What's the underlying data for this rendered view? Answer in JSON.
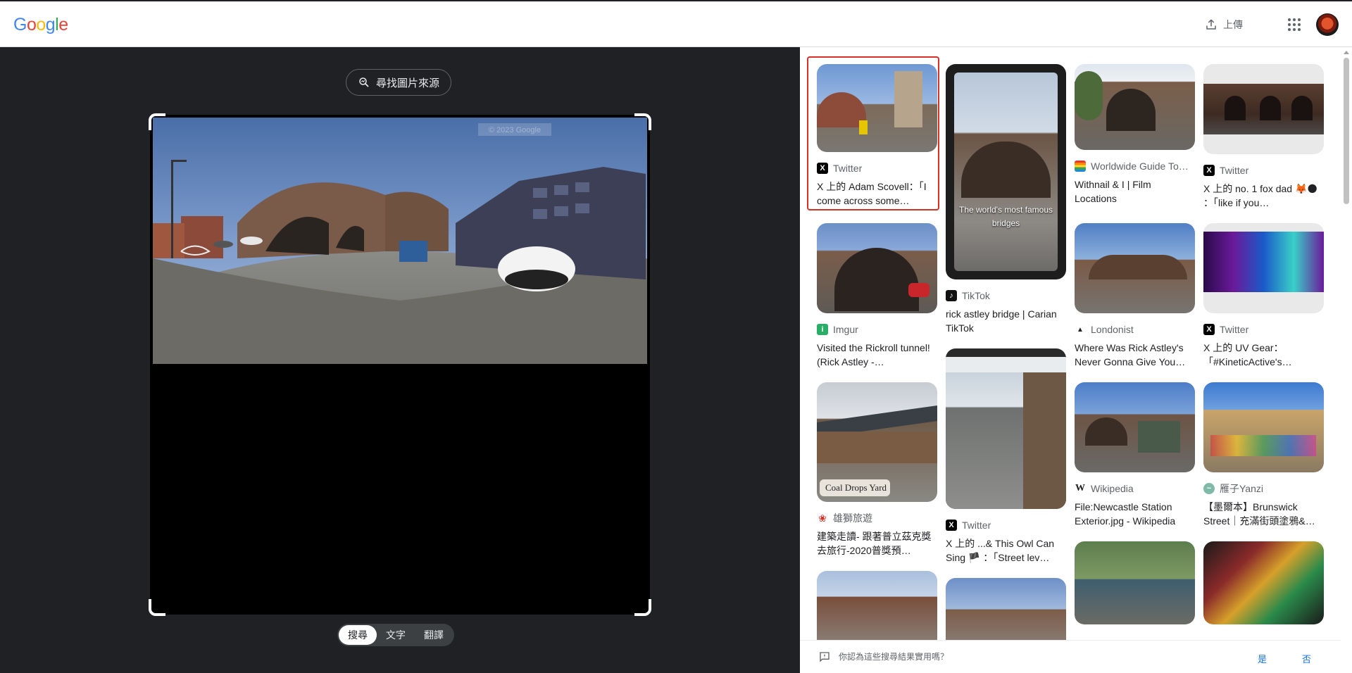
{
  "header": {
    "logo_letters": [
      {
        "ch": "G",
        "color": "#4285F4"
      },
      {
        "ch": "o",
        "color": "#EA4335"
      },
      {
        "ch": "o",
        "color": "#FBBC05"
      },
      {
        "ch": "g",
        "color": "#4285F4"
      },
      {
        "ch": "l",
        "color": "#34A853"
      },
      {
        "ch": "e",
        "color": "#EA4335"
      }
    ],
    "upload_label": "上傳",
    "upload_icon": "upload-icon",
    "apps_icon": "apps-grid-icon",
    "avatar_icon": "account-avatar"
  },
  "lens": {
    "find_source_label": "尋找圖片來源",
    "image_watermark": "© 2023 Google",
    "modes": [
      {
        "label": "搜尋",
        "active": true
      },
      {
        "label": "文字",
        "active": false
      },
      {
        "label": "翻譯",
        "active": false
      }
    ]
  },
  "results": [
    {
      "source": "Twitter",
      "source_icon": "x-icon",
      "title": "X 上的 Adam Scovell：「I come across some…",
      "selected": true,
      "overlay": ""
    },
    {
      "source": "TikTok",
      "source_icon": "tiktok-icon",
      "title": "rick astley bridge | Carian TikTok",
      "selected": false,
      "overlay": "The world's most famous bridges"
    },
    {
      "source": "Worldwide Guide To…",
      "source_icon": "rainbow-flag-icon",
      "title": "Withnail & I | Film Locations",
      "selected": false,
      "overlay": ""
    },
    {
      "source": "Twitter",
      "source_icon": "x-icon",
      "title": "X 上的 no. 1 fox dad 🦊🌑 ：「like if you…",
      "selected": false,
      "overlay": ""
    },
    {
      "source": "Imgur",
      "source_icon": "imgur-icon",
      "title": "Visited the Rickroll tunnel! (Rick Astley -…",
      "selected": false,
      "overlay": ""
    },
    {
      "source": "Twitter",
      "source_icon": "x-icon",
      "title": "X 上的 ...& This Owl Can Sing 🏴 ：「Street lev…",
      "selected": false,
      "overlay": ""
    },
    {
      "source": "Londonist",
      "source_icon": "londonist-icon",
      "title": "Where Was Rick Astley's Never Gonna Give You…",
      "selected": false,
      "overlay": ""
    },
    {
      "source": "Twitter",
      "source_icon": "x-icon",
      "title": "X 上的 UV Gear：「#KineticActive's…",
      "selected": false,
      "overlay": ""
    },
    {
      "source": "雄獅旅遊",
      "source_icon": "lion-travel-icon",
      "title": "建築走讀- 跟著普立茲克獎去旅行-2020普獎預…",
      "selected": false,
      "overlay": "Coal Drops Yard"
    },
    {
      "source": "Wikipedia",
      "source_icon": "wikipedia-icon",
      "title": "File:Newcastle Station Exterior.jpg - Wikipedia",
      "selected": false,
      "overlay": ""
    },
    {
      "source": "雁子Yanzi",
      "source_icon": "yanzi-icon",
      "title": "【墨爾本】Brunswick Street｜充滿街頭塗鴉&…",
      "selected": false,
      "overlay": ""
    }
  ],
  "feedback": {
    "question": "你認為這些搜尋結果實用嗎？",
    "yes": "是",
    "no": "否"
  }
}
